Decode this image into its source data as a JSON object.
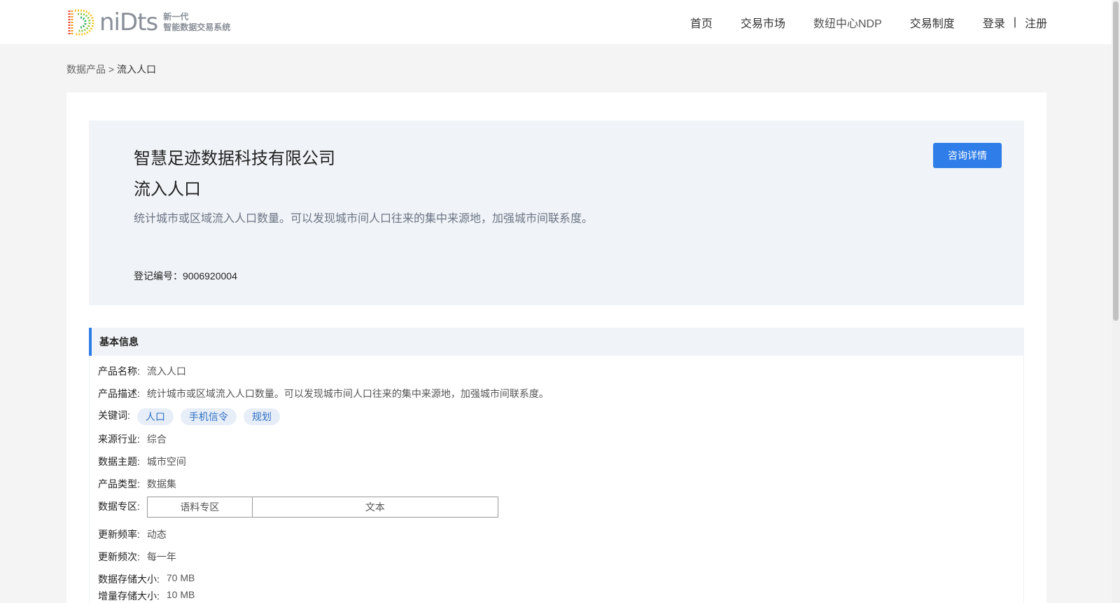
{
  "brand": {
    "wordmark": "niDts",
    "tagline_1": "新一代",
    "tagline_2": "智能数据交易系统"
  },
  "nav": {
    "items": [
      "首页",
      "交易市场",
      "数纽中心NDP",
      "交易制度"
    ],
    "login": "登录",
    "separator": "|",
    "register": "注册"
  },
  "breadcrumb": {
    "parent": "数据产品",
    "separator": ">",
    "current": "流入人口"
  },
  "hero": {
    "company": "智慧足迹数据科技有限公司",
    "product_name": "流入人口",
    "description": "统计城市或区域流入人口数量。可以发现城市间人口往来的集中来源地，加强城市间联系度。",
    "reg_label": "登记编号：",
    "reg_no": "9006920004",
    "consult_button": "咨询详情"
  },
  "basic_info": {
    "title": "基本信息",
    "product_name_label": "产品名称:",
    "product_name": "流入人口",
    "desc_label": "产品描述:",
    "desc": "统计城市或区域流入人口数量。可以发现城市间人口往来的集中来源地，加强城市间联系度。",
    "keywords_label": "关键词:",
    "keywords": [
      "人口",
      "手机信令",
      "规划"
    ],
    "industry_label": "来源行业:",
    "industry": "综合",
    "theme_label": "数据主题:",
    "theme": "城市空间",
    "type_label": "产品类型:",
    "type": "数据集",
    "zone_label": "数据专区:",
    "zone_name": "语料专区",
    "zone_value": "文本",
    "freq_label": "更新频率:",
    "freq": "动态",
    "cycle_label": "更新频次:",
    "cycle": "每一年",
    "size_label": "数据存储大小:",
    "size": "70 MB",
    "inc_label": "增量存储大小:",
    "inc": "10 MB"
  },
  "colors": {
    "accent": "#2f7de8",
    "tag_bg": "#e7eef8",
    "hero_bg": "#f0f3f7"
  }
}
